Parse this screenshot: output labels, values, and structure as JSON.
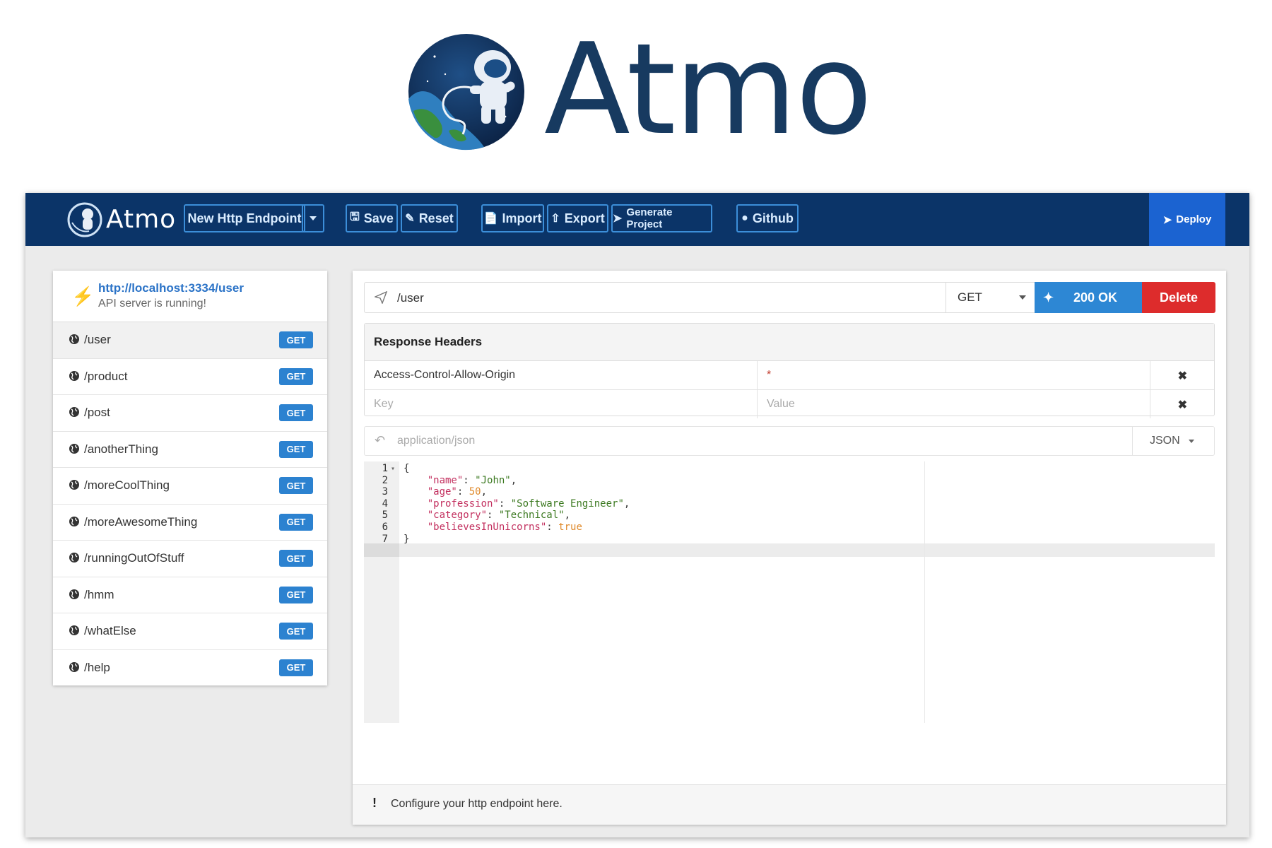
{
  "hero": {
    "title": "Atmo"
  },
  "navbar": {
    "brand": "Atmo",
    "new_endpoint": "New Http Endpoint",
    "save": "Save",
    "reset": "Reset",
    "import": "Import",
    "export": "Export",
    "generate": "Generate Project",
    "github": "Github",
    "deploy": "Deploy"
  },
  "sidebar": {
    "server_url": "http://localhost:3334/user",
    "server_status": "API server is running!",
    "routes": [
      {
        "path": "/user",
        "method": "GET"
      },
      {
        "path": "/product",
        "method": "GET"
      },
      {
        "path": "/post",
        "method": "GET"
      },
      {
        "path": "/anotherThing",
        "method": "GET"
      },
      {
        "path": "/moreCoolThing",
        "method": "GET"
      },
      {
        "path": "/moreAwesomeThing",
        "method": "GET"
      },
      {
        "path": "/runningOutOfStuff",
        "method": "GET"
      },
      {
        "path": "/hmm",
        "method": "GET"
      },
      {
        "path": "/whatElse",
        "method": "GET"
      },
      {
        "path": "/help",
        "method": "GET"
      }
    ]
  },
  "endpoint": {
    "path": "/user",
    "method": "GET",
    "status": "200 OK",
    "delete": "Delete"
  },
  "headers": {
    "title": "Response Headers",
    "rows": [
      {
        "key": "Access-Control-Allow-Origin",
        "value": "*"
      }
    ],
    "key_placeholder": "Key",
    "value_placeholder": "Value"
  },
  "content_type": {
    "value": "application/json",
    "format": "JSON"
  },
  "editor": {
    "line_numbers": [
      "1",
      "2",
      "3",
      "4",
      "5",
      "6",
      "7"
    ],
    "lines": [
      "{",
      "    \"name\": \"John\",",
      "    \"age\": 50,",
      "    \"profession\": \"Software Engineer\",",
      "    \"category\": \"Technical\",",
      "    \"believesInUnicorns\": true",
      "}"
    ]
  },
  "footer": {
    "icon": "!",
    "message": "Configure your http endpoint here."
  },
  "colors": {
    "navbar": "#0b3468",
    "accent": "#2d87d4",
    "deploy": "#1b63d1",
    "danger": "#dd2c2c",
    "ok_icon": "#25b125"
  }
}
